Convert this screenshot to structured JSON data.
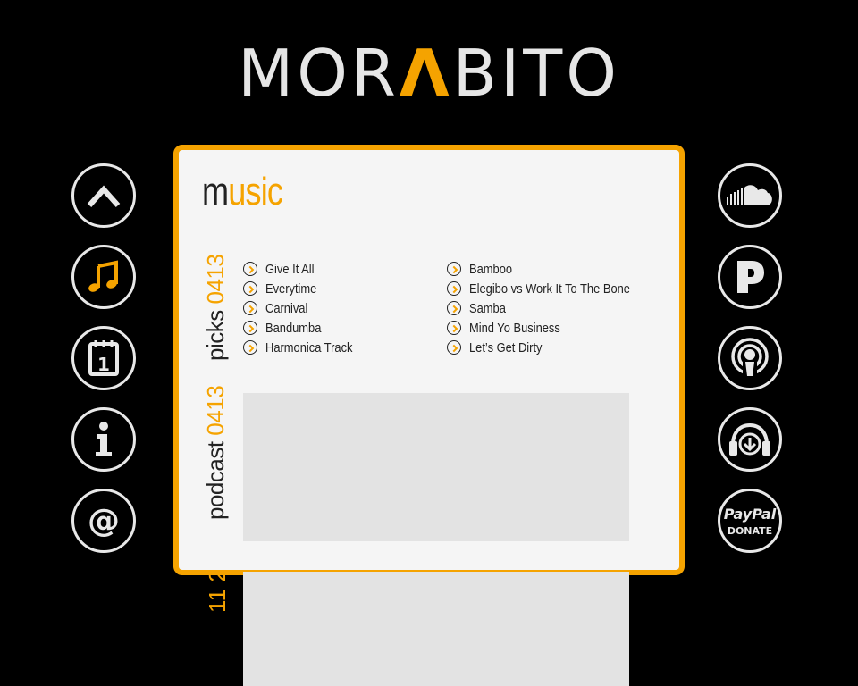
{
  "logo": {
    "before": "MOR",
    "accent": "Λ",
    "after": "BITO"
  },
  "left_nav": [
    {
      "name": "up-icon"
    },
    {
      "name": "music-note-icon",
      "active": true
    },
    {
      "name": "calendar-icon",
      "day": "1"
    },
    {
      "name": "info-icon"
    },
    {
      "name": "at-sign-icon"
    }
  ],
  "right_nav": [
    {
      "name": "soundcloud-icon"
    },
    {
      "name": "pandora-icon"
    },
    {
      "name": "podcast-icon"
    },
    {
      "name": "download-headphones-icon"
    },
    {
      "name": "paypal-donate-icon",
      "line1": "PayPal",
      "line2": "DONATE"
    }
  ],
  "section": {
    "title_first": "m",
    "title_rest": "usic"
  },
  "picks": {
    "label": "picks",
    "number": "0413",
    "column1": [
      "Give It All",
      "Everytime",
      "Carnival",
      "Bandumba",
      "Harmonica Track"
    ],
    "column2": [
      "Bamboo",
      "Elegibo vs Work It To The Bone",
      "Samba",
      "Mind Yo Business",
      "Let’s Get Dirty"
    ]
  },
  "podcast": {
    "label": "podcast",
    "number": "0413"
  },
  "below": {
    "number": "11 2"
  },
  "colors": {
    "accent": "#f5a300",
    "background": "#000000",
    "card": "#f5f5f5",
    "placeholder": "#e3e3e3"
  }
}
